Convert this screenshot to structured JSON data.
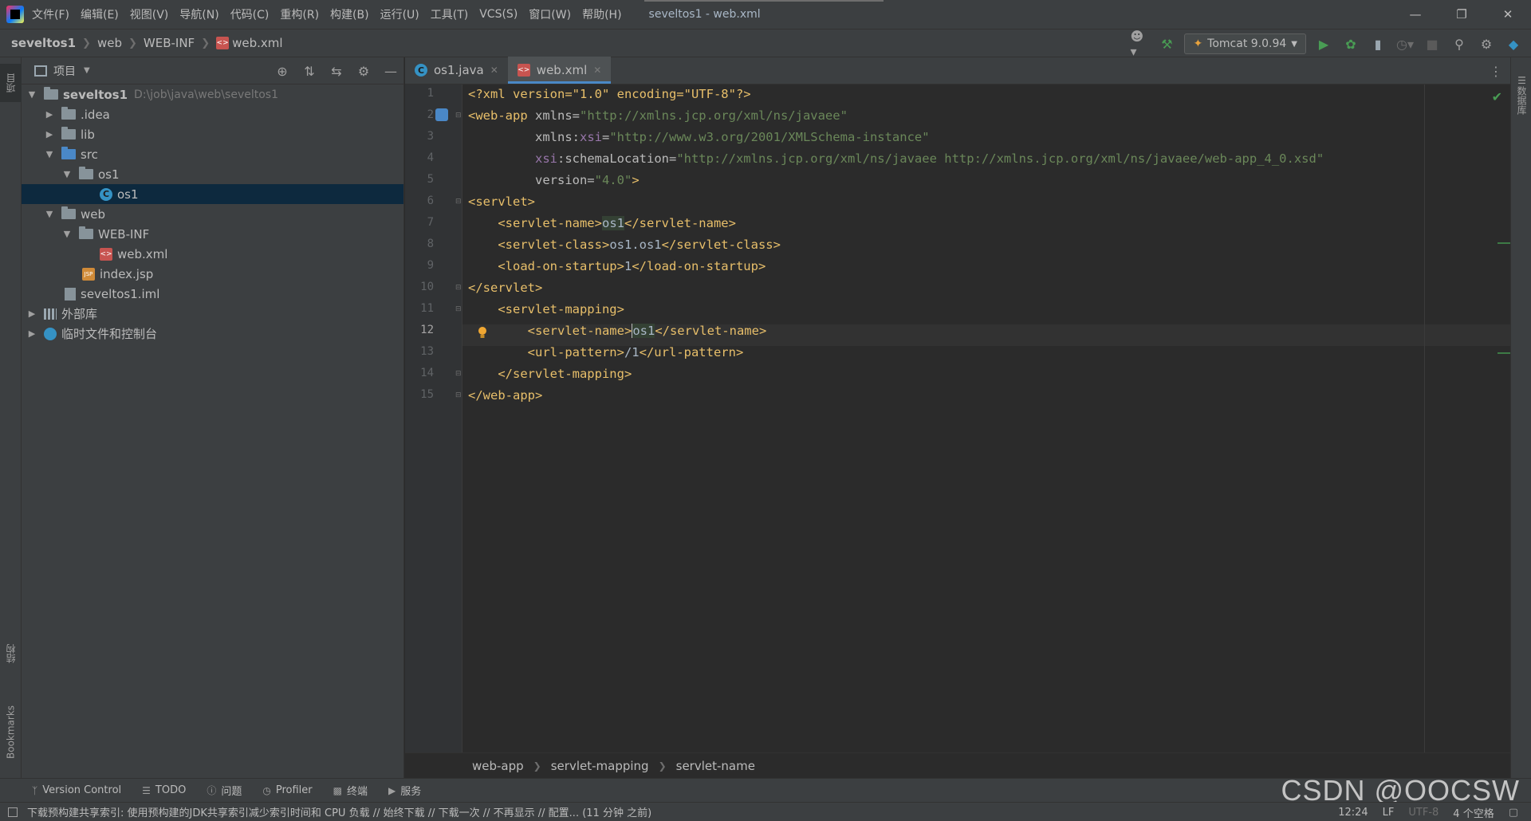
{
  "menubar": {
    "items": [
      "文件(F)",
      "编辑(E)",
      "视图(V)",
      "导航(N)",
      "代码(C)",
      "重构(R)",
      "构建(B)",
      "运行(U)",
      "工具(T)",
      "VCS(S)",
      "窗口(W)",
      "帮助(H)"
    ],
    "title": "seveltos1 - web.xml"
  },
  "navbar": {
    "breadcrumb": [
      "seveltos1",
      "web",
      "WEB-INF",
      "web.xml"
    ],
    "run_config": "Tomcat 9.0.94"
  },
  "left_strip": {
    "project_tab": "项目",
    "structure_tab": "结构",
    "bookmarks_tab": "Bookmarks"
  },
  "right_strip": {
    "database_tab": "数据库"
  },
  "project_panel": {
    "title": "项目",
    "tree": [
      {
        "label": "seveltos1",
        "path": "D:\\job\\java\\web\\seveltos1"
      },
      {
        "label": ".idea"
      },
      {
        "label": "lib"
      },
      {
        "label": "src"
      },
      {
        "label": "os1"
      },
      {
        "label": "os1"
      },
      {
        "label": "web"
      },
      {
        "label": "WEB-INF"
      },
      {
        "label": "web.xml"
      },
      {
        "label": "index.jsp"
      },
      {
        "label": "seveltos1.iml"
      },
      {
        "label": "外部库"
      },
      {
        "label": "临时文件和控制台"
      }
    ]
  },
  "editor_tabs": [
    {
      "label": "os1.java"
    },
    {
      "label": "web.xml"
    }
  ],
  "editor": {
    "line_numbers": [
      "1",
      "2",
      "3",
      "4",
      "5",
      "6",
      "7",
      "8",
      "9",
      "10",
      "11",
      "12",
      "13",
      "14",
      "15"
    ],
    "current_line": "12",
    "lines": [
      [
        "<?xml version=\"1.0\" encoding=\"UTF-8\"?>"
      ],
      [
        "<web-app",
        " xmlns=",
        "\"http://xmlns.jcp.org/xml/ns/javaee\""
      ],
      [
        "         xmlns:",
        "xsi",
        "=",
        "\"http://www.w3.org/2001/XMLSchema-instance\""
      ],
      [
        "         ",
        "xsi",
        ":schemaLocation=",
        "\"http://xmlns.jcp.org/xml/ns/javaee http://xmlns.jcp.org/xml/ns/javaee/web-app_4_0.xsd\""
      ],
      [
        "         version=",
        "\"4.0\"",
        ">"
      ],
      [
        "<servlet>"
      ],
      [
        "    <servlet-name>",
        "os1",
        "</servlet-name>"
      ],
      [
        "    <servlet-class>",
        "os1.os1",
        "</servlet-class>"
      ],
      [
        "    <load-on-startup>",
        "1",
        "</load-on-startup>"
      ],
      [
        "</servlet>"
      ],
      [
        "    <servlet-mapping>"
      ],
      [
        "        <servlet-name>",
        "os1",
        "</servlet-name>"
      ],
      [
        "        <url-pattern>",
        "/1",
        "</url-pattern>"
      ],
      [
        "    </servlet-mapping>"
      ],
      [
        "</web-app>"
      ]
    ]
  },
  "editor_breadcrumb": [
    "web-app",
    "servlet-mapping",
    "servlet-name"
  ],
  "toolwindows": [
    "Version Control",
    "TODO",
    "问题",
    "Profiler",
    "终端",
    "服务"
  ],
  "watermark": "CSDN @OOCSW",
  "statusbar": {
    "message": "下载预构建共享索引: 使用预构建的JDK共享索引减少索引时间和 CPU 负载 // 始终下载 // 下载一次 // 不再显示 // 配置... (11 分钟 之前)",
    "position": "12:24",
    "line_sep": "LF",
    "encoding": "UTF-8",
    "indent": "4 个空格"
  },
  "colors": {
    "accent": "#4a88c7",
    "selection": "#0d293e",
    "tag": "#e8bf6a",
    "string": "#6a8759"
  }
}
